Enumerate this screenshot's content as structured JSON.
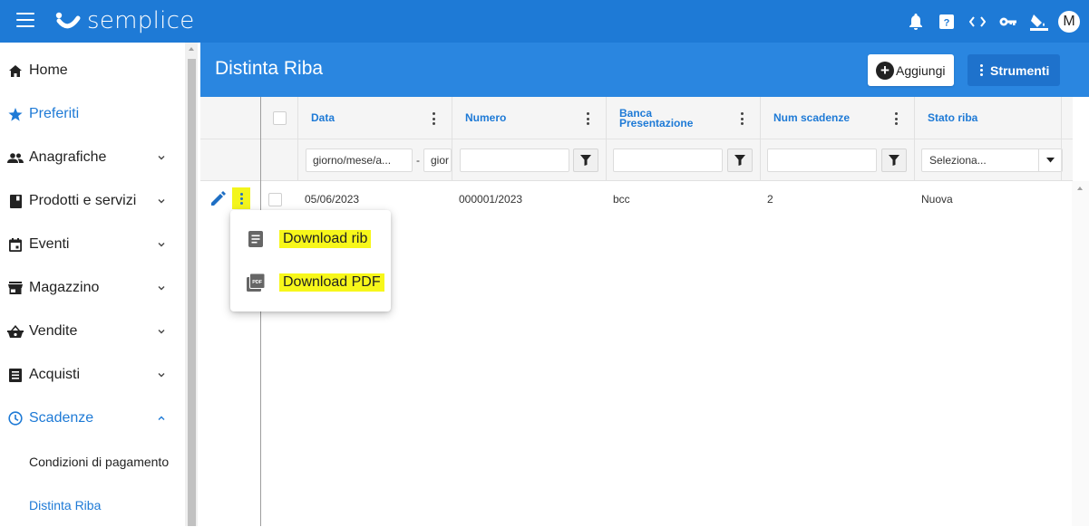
{
  "app": {
    "name": "semplice",
    "user_initial": "M",
    "colors": {
      "primary": "#1e7ad6",
      "header": "#2a86e0",
      "highlight": "#f7f71a"
    },
    "top_icons": [
      "bell-icon",
      "help-icon",
      "code-icon",
      "key-icon",
      "paint-bucket-icon"
    ]
  },
  "sidebar": {
    "items": [
      {
        "label": "Home",
        "icon": "home-icon"
      },
      {
        "label": "Preferiti",
        "icon": "star-icon"
      },
      {
        "label": "Anagrafiche",
        "icon": "people-icon"
      },
      {
        "label": "Prodotti e servizi",
        "icon": "book-icon"
      },
      {
        "label": "Eventi",
        "icon": "calendar-icon"
      },
      {
        "label": "Magazzino",
        "icon": "store-icon"
      },
      {
        "label": "Vendite",
        "icon": "basket-icon"
      },
      {
        "label": "Acquisti",
        "icon": "list-icon"
      },
      {
        "label": "Scadenze",
        "icon": "clock-icon"
      }
    ],
    "sub_items": [
      {
        "label": "Condizioni di pagamento"
      },
      {
        "label": "Distinta Riba"
      }
    ]
  },
  "page": {
    "title": "Distinta Riba",
    "add_label": "Aggiungi",
    "tools_label": "Strumenti"
  },
  "grid": {
    "columns": [
      "Data",
      "Numero",
      "Banca Presentazione",
      "Num scadenze",
      "Stato riba"
    ],
    "filters": {
      "date_from": "giorno/mese/a...",
      "date_sep": "-",
      "date_to": "gior",
      "status_select": "Seleziona..."
    },
    "rows": [
      {
        "data": "05/06/2023",
        "numero": "000001/2023",
        "banca": "bcc",
        "num_scadenze": "2",
        "stato": "Nuova"
      }
    ]
  },
  "context_menu": {
    "items": [
      {
        "label": "Download rib",
        "icon": "document-icon"
      },
      {
        "label": "Download PDF",
        "icon": "pdf-icon"
      }
    ]
  }
}
